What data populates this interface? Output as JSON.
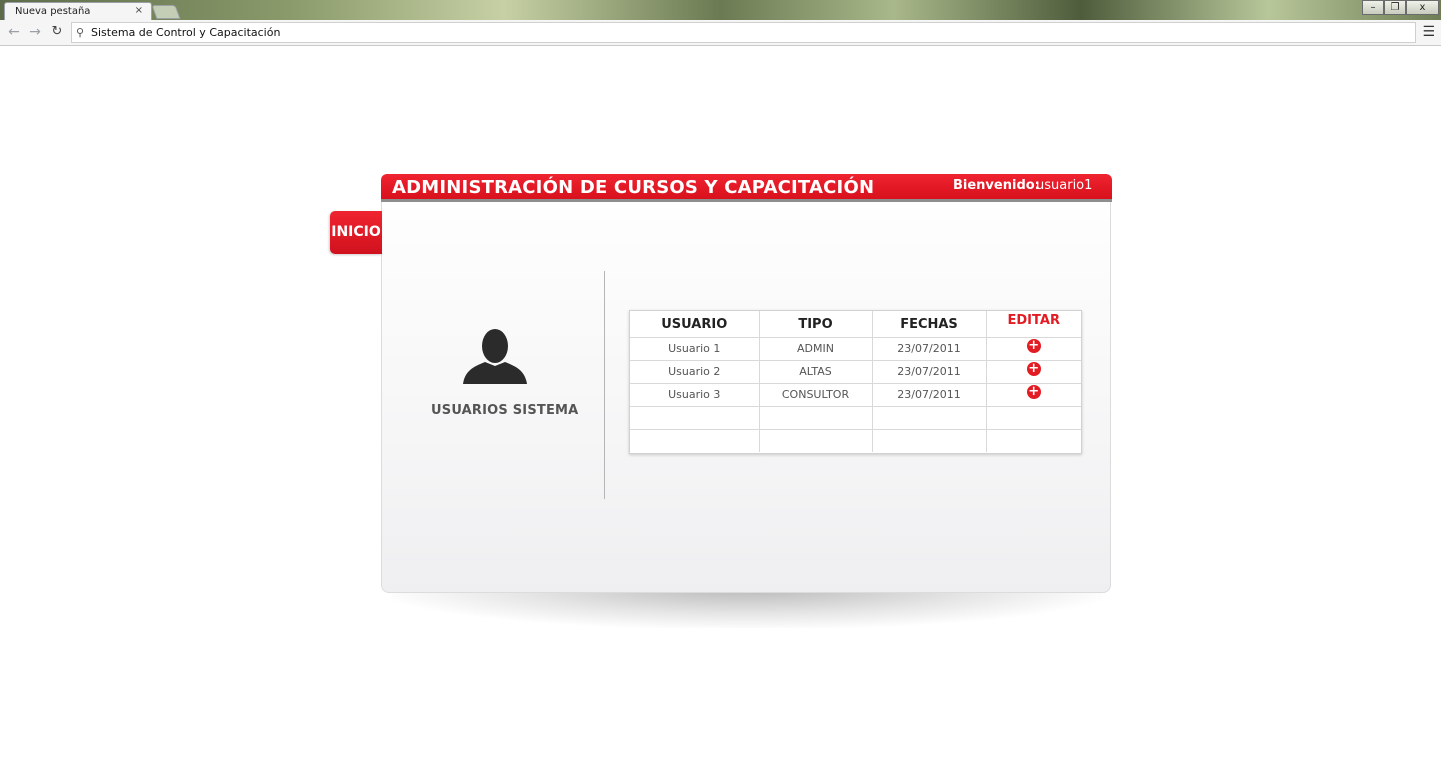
{
  "browser": {
    "tab_title": "Nueva pestaña",
    "tab_close": "×",
    "address": "Sistema de Control y Capacitación",
    "window_controls": {
      "minimize": "–",
      "restore": "❐",
      "close": "x"
    },
    "icons": {
      "back": "back-arrow-icon",
      "forward": "forward-arrow-icon",
      "reload": "reload-icon",
      "search": "search-icon",
      "menu": "hamburger-menu-icon"
    }
  },
  "app": {
    "title": "ADMINISTRACIÓN DE CURSOS Y CAPACITACIÓN",
    "welcome_label": "Bienvenido:",
    "welcome_user": "usuario1",
    "nav_tab": "INICIO",
    "section_label": "USUARIOS SISTEMA",
    "accent_color": "#e31b23"
  },
  "users_table": {
    "headers": [
      "USUARIO",
      "TIPO",
      "FECHAS",
      "EDITAR"
    ],
    "rows": [
      {
        "usuario": "Usuario 1",
        "tipo": "ADMIN",
        "fecha": "23/07/2011",
        "edit_icon": "+"
      },
      {
        "usuario": "Usuario 2",
        "tipo": "ALTAS",
        "fecha": "23/07/2011",
        "edit_icon": "+"
      },
      {
        "usuario": "Usuario 3",
        "tipo": "CONSULTOR",
        "fecha": "23/07/2011",
        "edit_icon": "+"
      }
    ],
    "empty_rows": 2
  }
}
